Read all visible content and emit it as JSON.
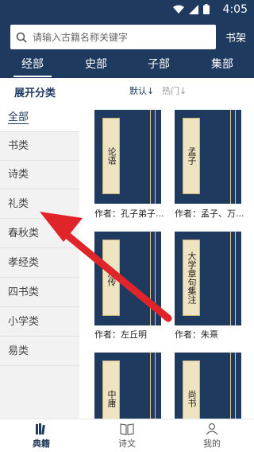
{
  "status": {
    "time": "4:05"
  },
  "search": {
    "placeholder": "请输入古籍名称关键字"
  },
  "header": {
    "shelf_label": "书架"
  },
  "tabs": [
    {
      "label": "经部",
      "active": true
    },
    {
      "label": "史部",
      "active": false
    },
    {
      "label": "子部",
      "active": false
    },
    {
      "label": "集部",
      "active": false
    }
  ],
  "sortbar": {
    "expand_label": "展开分类",
    "default_label": "默认↓",
    "hot_label": "热门↓"
  },
  "sidebar": {
    "items": [
      {
        "label": "全部",
        "active": true
      },
      {
        "label": "书类"
      },
      {
        "label": "诗类"
      },
      {
        "label": "礼类"
      },
      {
        "label": "春秋类"
      },
      {
        "label": "孝经类"
      },
      {
        "label": "四书类"
      },
      {
        "label": "小学类"
      },
      {
        "label": "易类"
      }
    ]
  },
  "books": [
    {
      "title": "论语",
      "author": "作者：孔子弟子..."
    },
    {
      "title": "孟子",
      "author": "作者：孟子、万..."
    },
    {
      "title": "左传",
      "author": "作者：左丘明"
    },
    {
      "title": "大学章句集注",
      "author": "作者：朱熹"
    },
    {
      "title": "中庸",
      "author": ""
    },
    {
      "title": "尚书",
      "author": ""
    }
  ],
  "bottomnav": {
    "items": [
      {
        "label": "典籍",
        "icon": "books-icon",
        "active": true
      },
      {
        "label": "诗文",
        "icon": "open-book-icon"
      },
      {
        "label": "我的",
        "icon": "profile-icon"
      }
    ]
  },
  "colors": {
    "primary": "#1e3a5f",
    "accent_arrow": "#e0252a",
    "label_paper": "#f0e3c2"
  }
}
